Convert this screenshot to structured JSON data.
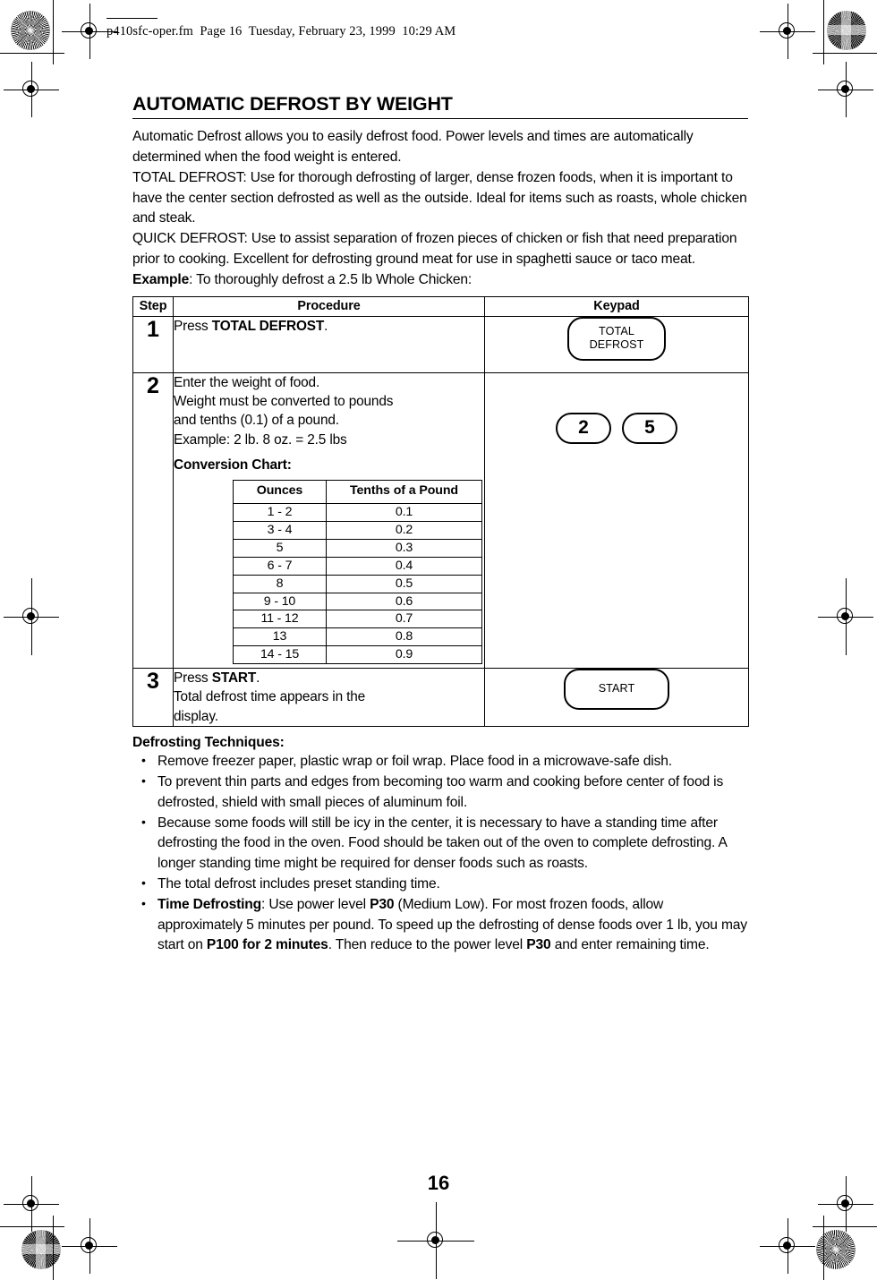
{
  "slug": {
    "text": "p410sfc-oper.fm  Page 16  Tuesday, February 23, 1999  10:29 AM"
  },
  "document": {
    "title": "AUTOMATIC DEFROST BY WEIGHT",
    "page_number": "16"
  },
  "intro": {
    "line1": "Automatic Defrost allows you to easily defrost food. Power levels and times are automatically determined when the food weight is entered.",
    "line2": "TOTAL DEFROST: Use for thorough defrosting of larger, dense frozen foods, when it is important to have the center section defrosted as well as the outside. Ideal for items such as roasts, whole chicken and steak.",
    "line3": "QUICK DEFROST: Use to assist separation of frozen pieces of chicken or fish that need preparation prior to cooking. Excellent for defrosting ground meat for use in spaghetti sauce or taco meat.",
    "example_label": "Example",
    "example_text": ": To thoroughly defrost a 2.5 lb Whole Chicken:"
  },
  "procedure_table": {
    "headers": {
      "step": "Step",
      "procedure": "Procedure",
      "keypad": "Keypad"
    },
    "rows": [
      {
        "step": "1",
        "procedure_prefix": "Press ",
        "procedure_bold": "TOTAL DEFROST",
        "procedure_suffix": ".",
        "keypad_button": "TOTAL\nDEFROST"
      },
      {
        "step": "2",
        "line1": "Enter the weight of food.",
        "line2": "Weight must be converted to pounds",
        "line3": "and tenths (0.1) of a pound.",
        "line4": "Example: 2 lb. 8 oz. = 2.5 lbs",
        "conversion_label": "Conversion Chart:",
        "keypad_buttons": [
          "2",
          "5"
        ]
      },
      {
        "step": "3",
        "procedure_prefix": "Press ",
        "procedure_bold": "START",
        "procedure_suffix": ".",
        "line2": "Total defrost time appears in the",
        "line3": "display.",
        "keypad_button": "START"
      }
    ]
  },
  "conversion_chart": {
    "headers": [
      "Ounces",
      "Tenths of a Pound"
    ],
    "rows": [
      {
        "ounces": "1 - 2",
        "tenths": "0.1"
      },
      {
        "ounces": "3 - 4",
        "tenths": "0.2"
      },
      {
        "ounces": "5",
        "tenths": "0.3"
      },
      {
        "ounces": "6 - 7",
        "tenths": "0.4"
      },
      {
        "ounces": "8",
        "tenths": "0.5"
      },
      {
        "ounces": "9 - 10",
        "tenths": "0.6"
      },
      {
        "ounces": "11 - 12",
        "tenths": "0.7"
      },
      {
        "ounces": "13",
        "tenths": "0.8"
      },
      {
        "ounces": "14 - 15",
        "tenths": "0.9"
      }
    ]
  },
  "techniques": {
    "title": "Defrosting Techniques:",
    "items": [
      "Remove freezer paper, plastic wrap or foil wrap. Place food in a microwave-safe dish.",
      "To prevent thin parts and edges from becoming too warm and cooking before center of food is defrosted, shield with small pieces of aluminum foil.",
      "Because some foods will still be icy in the center, it is necessary to have a standing time after defrosting the food in the oven. Food should be taken out of the oven to complete defrosting. A longer standing time might be required for denser foods such as roasts.",
      "The total defrost includes preset standing time."
    ],
    "last_item": {
      "bold1": "Time Defrosting",
      "text1": ": Use power level ",
      "bold2": "P30",
      "text2": " (Medium Low). For most frozen foods, allow approximately 5 minutes per pound. To speed up the defrosting of dense foods over 1 lb, you may start on ",
      "bold3": "P100 for 2 minutes",
      "text3": ". Then reduce to the power level ",
      "bold4": "P30",
      "text4": " and enter remaining time."
    }
  }
}
